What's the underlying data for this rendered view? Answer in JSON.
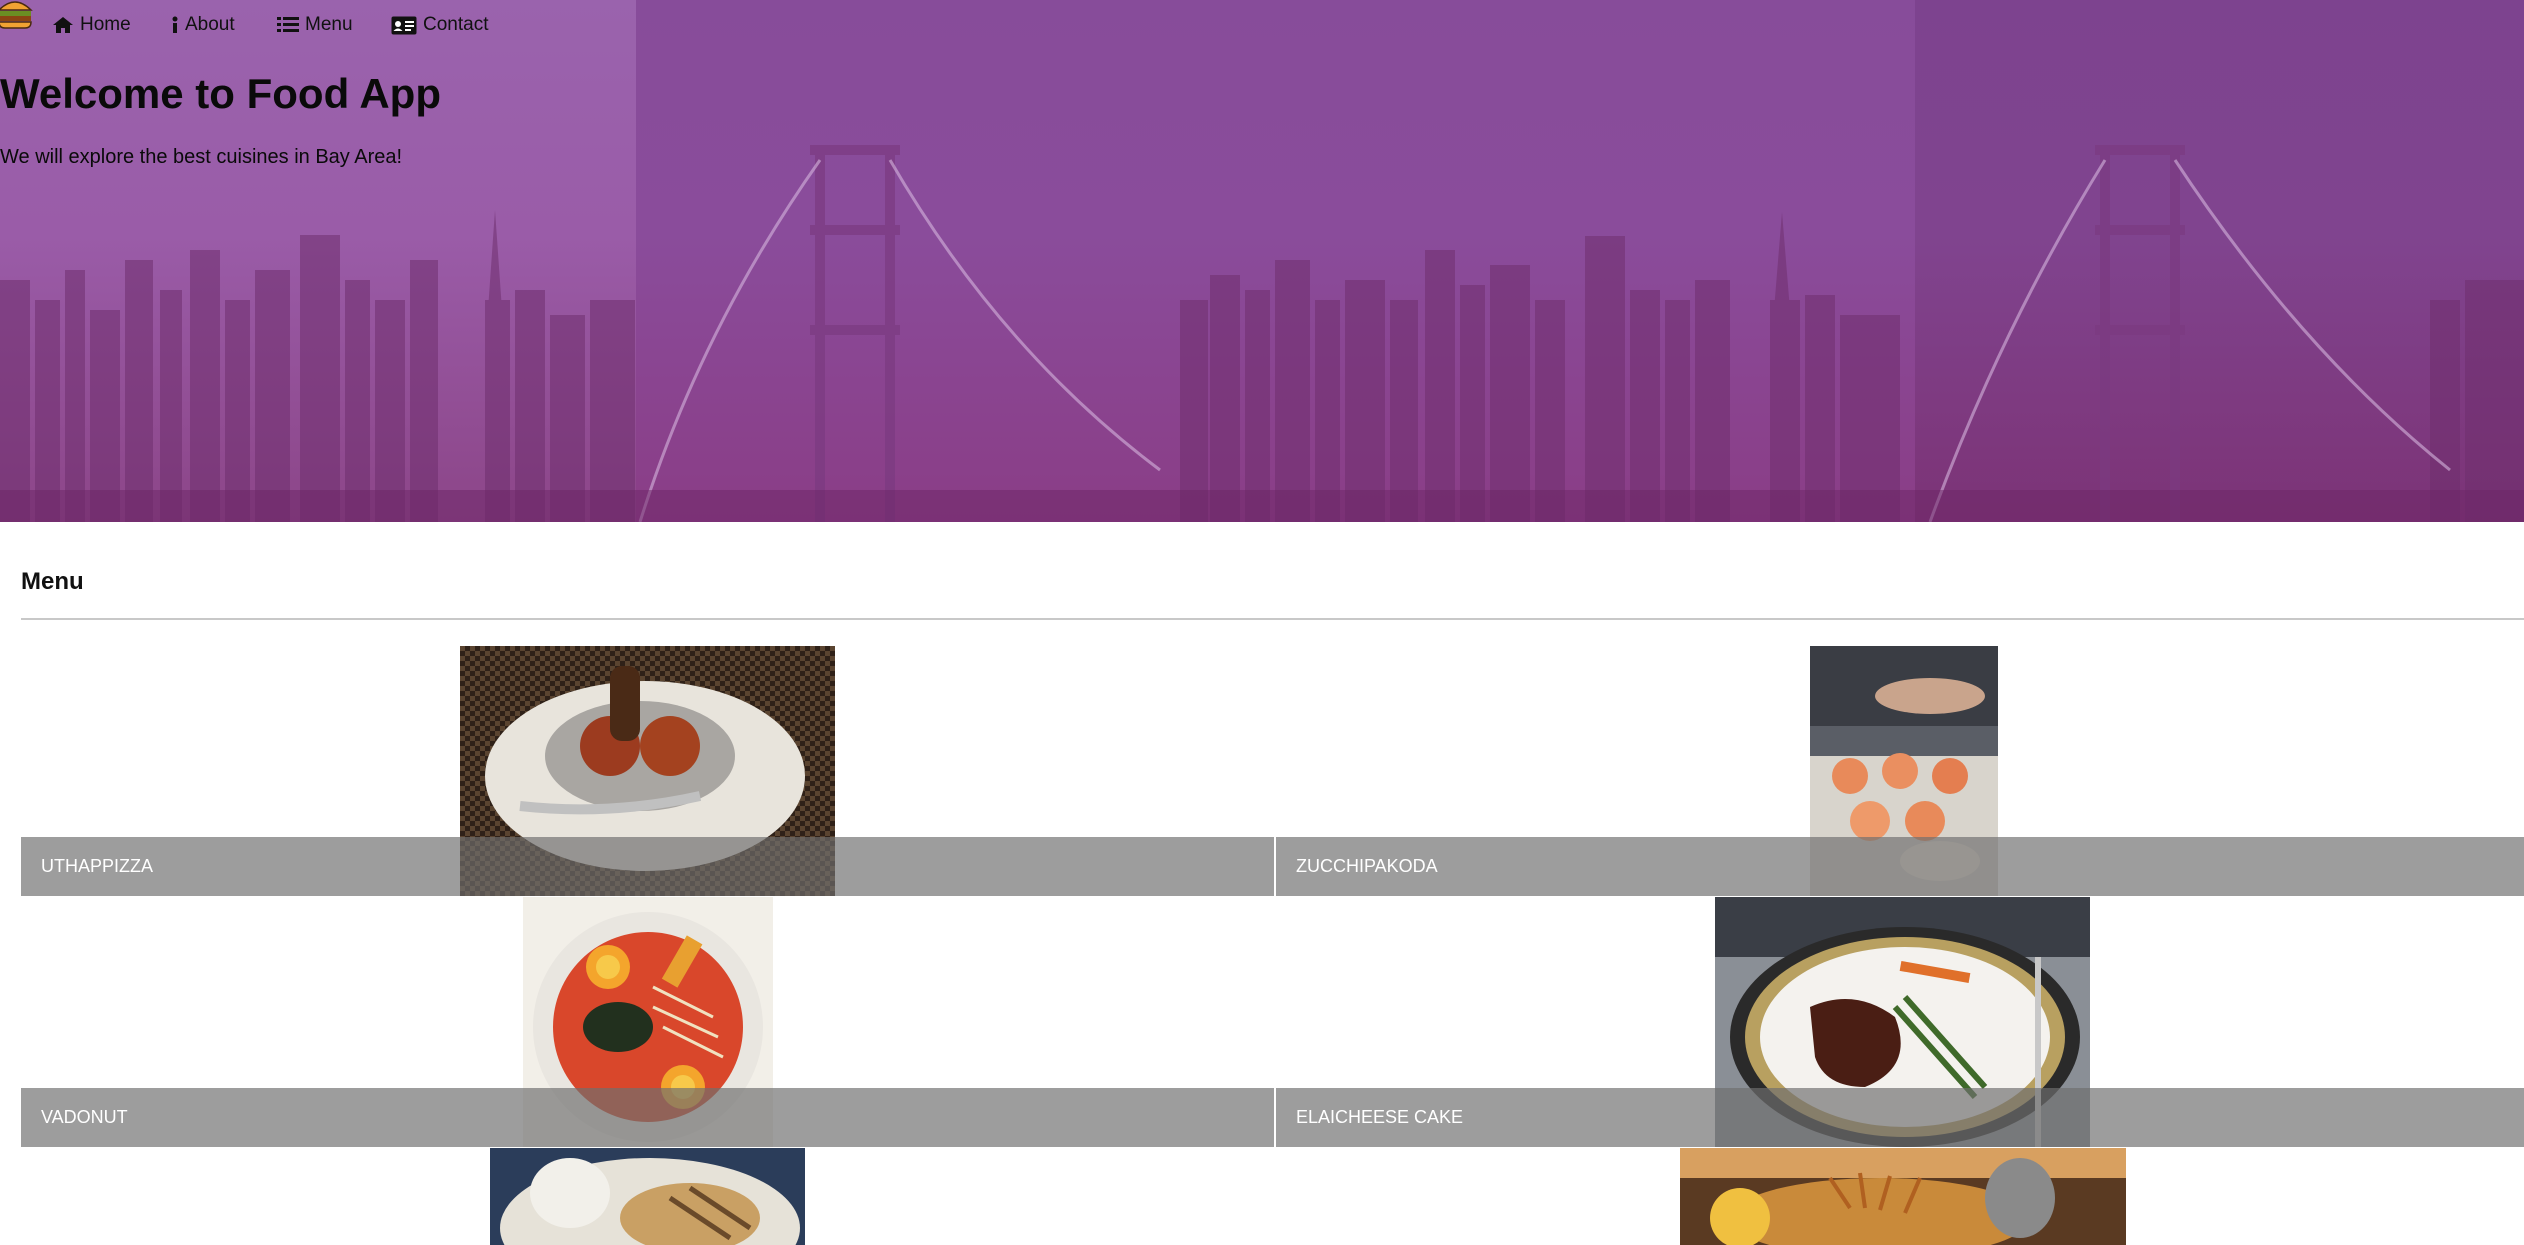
{
  "nav": {
    "items": [
      {
        "label": "Home",
        "icon": "home-icon"
      },
      {
        "label": "About",
        "icon": "info-icon"
      },
      {
        "label": "Menu",
        "icon": "list-icon"
      },
      {
        "label": "Contact",
        "icon": "address-card-icon"
      }
    ],
    "brand_icon": "burger-logo-icon"
  },
  "hero": {
    "title": "Welcome to Food App",
    "subtitle": "We will explore the best cuisines in Bay Area!"
  },
  "menu": {
    "heading": "Menu",
    "items": [
      {
        "name": "UTHAPPIZZA"
      },
      {
        "name": "ZUCCHIPAKODA"
      },
      {
        "name": "VADONUT"
      },
      {
        "name": "ELAICHEESE CAKE"
      },
      {
        "name": ""
      },
      {
        "name": ""
      }
    ]
  },
  "colors": {
    "hero_purple": "#8a4c9b",
    "caption_overlay": "#9a9a9a",
    "text": "#111111"
  }
}
